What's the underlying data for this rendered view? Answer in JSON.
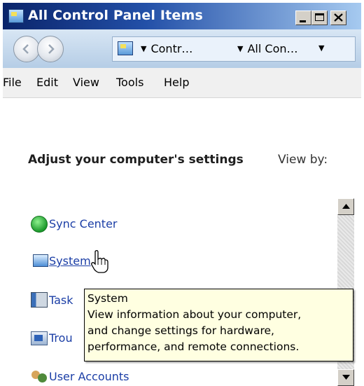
{
  "window": {
    "title": "All Control Panel Items",
    "title_icon": "control-panel-icon",
    "buttons": {
      "minimize": "minimize-icon",
      "maximize": "maximize-icon",
      "close": "close-icon"
    }
  },
  "addressbar": {
    "back_icon": "back-arrow-icon",
    "forward_icon": "forward-arrow-icon",
    "crumbs": [
      "Contr…",
      "All Con…"
    ]
  },
  "menu": {
    "items": [
      "File",
      "Edit",
      "View",
      "Tools",
      "Help"
    ]
  },
  "content": {
    "heading": "Adjust your computer's settings",
    "view_by_label": "View by:",
    "items": [
      {
        "label": "Sync Center",
        "icon": "sync-center-icon"
      },
      {
        "label": "System",
        "icon": "system-icon"
      },
      {
        "label": "Task",
        "icon": "taskbar-icon"
      },
      {
        "label": "Trou",
        "icon": "troubleshooting-icon"
      },
      {
        "label": "User Accounts",
        "icon": "user-accounts-icon"
      }
    ]
  },
  "tooltip": {
    "title": "System",
    "lines": [
      "View information about your computer,",
      "and change settings for hardware,",
      "performance, and remote connections."
    ]
  },
  "colors": {
    "title_gradient_start": "#0a246a",
    "title_gradient_end": "#a6caf0",
    "link": "#1b3ea6",
    "tooltip_bg": "#ffffe1"
  }
}
